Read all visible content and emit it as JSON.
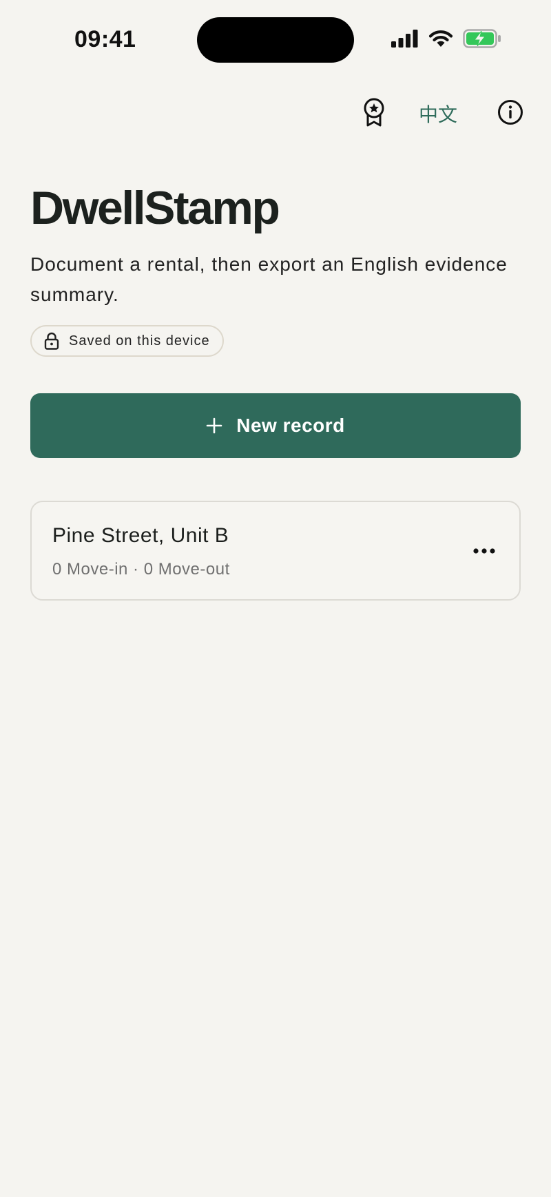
{
  "status_bar": {
    "time": "09:41",
    "icons": [
      "signal-icon",
      "wifi-icon",
      "battery-charging-icon"
    ],
    "battery_color": "#34c759"
  },
  "toolbar": {
    "award_icon": "award-ribbon-icon",
    "language_label": "中文",
    "info_icon": "info-icon"
  },
  "header": {
    "title": "DwellStamp",
    "subtitle": "Document a rental, then export an English evidence summary.",
    "saved_badge": {
      "icon": "lock-icon",
      "label": "Saved on this device"
    }
  },
  "actions": {
    "new_record": {
      "icon": "plus-icon",
      "label": "New record"
    }
  },
  "records": [
    {
      "title": "Pine Street, Unit B",
      "meta": "0 Move-in · 0 Move-out",
      "menu_icon": "more-horizontal-icon"
    }
  ],
  "colors": {
    "background": "#f5f4f0",
    "accent": "#2f6a5b",
    "accent_text": "#2e6b5a",
    "text_primary": "#1c1f1d",
    "text_secondary": "#707070",
    "border": "#dcdad4"
  }
}
